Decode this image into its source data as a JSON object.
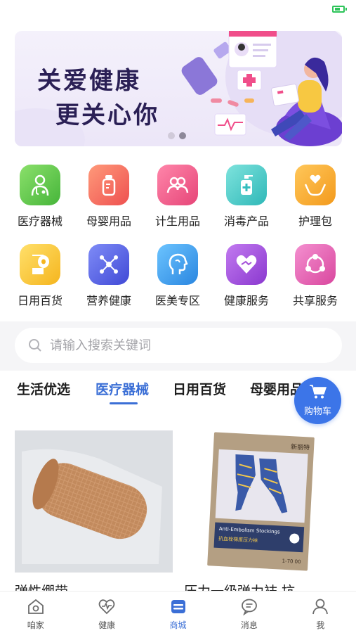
{
  "banner": {
    "line1": "关爱健康",
    "line2": "更关心你",
    "page_count": 2,
    "active_page": 2
  },
  "categories": [
    {
      "label": "医疗器械",
      "icon": "doctor-icon",
      "color": "#6cc84a"
    },
    {
      "label": "母婴用品",
      "icon": "baby-bottle-icon",
      "color": "#f36b5f"
    },
    {
      "label": "计生用品",
      "icon": "couple-icon",
      "color": "#ef5a8a"
    },
    {
      "label": "消毒产品",
      "icon": "sanitizer-icon",
      "color": "#49c9c8"
    },
    {
      "label": "护理包",
      "icon": "care-hands-icon",
      "color": "#f5a623"
    },
    {
      "label": "日用百货",
      "icon": "tissue-roll-icon",
      "color": "#f8c832"
    },
    {
      "label": "营养健康",
      "icon": "molecule-icon",
      "color": "#5a67e8"
    },
    {
      "label": "医美专区",
      "icon": "face-profile-icon",
      "color": "#3f9be8"
    },
    {
      "label": "健康服务",
      "icon": "heart-hand-icon",
      "color": "#a552d9"
    },
    {
      "label": "共享服务",
      "icon": "share-icon",
      "color": "#e567b8"
    }
  ],
  "search": {
    "placeholder": "请输入搜索关键词"
  },
  "tabs": [
    {
      "label": "生活优选",
      "active": false
    },
    {
      "label": "医疗器械",
      "active": true
    },
    {
      "label": "日用百货",
      "active": false
    },
    {
      "label": "母婴用品",
      "active": false
    }
  ],
  "cart": {
    "label": "购物车"
  },
  "products": [
    {
      "name": "弹性绷带"
    },
    {
      "name": "压力一级弹力袜 抗",
      "package_brand": "新丽特",
      "package_en": "Anti-Embolism Stockings",
      "package_cn": "抗血栓梯度压力袜",
      "package_code": "1-70 00"
    }
  ],
  "bottom_nav": [
    {
      "label": "咱家",
      "icon": "home-icon",
      "active": false
    },
    {
      "label": "健康",
      "icon": "heartbeat-icon",
      "active": false
    },
    {
      "label": "商城",
      "icon": "store-icon",
      "active": true
    },
    {
      "label": "消息",
      "icon": "message-icon",
      "active": false
    },
    {
      "label": "我",
      "icon": "user-icon",
      "active": false
    }
  ],
  "colors": {
    "accent": "#3b6fd6",
    "cart": "#3c75e8",
    "battery": "#2ec45a"
  }
}
